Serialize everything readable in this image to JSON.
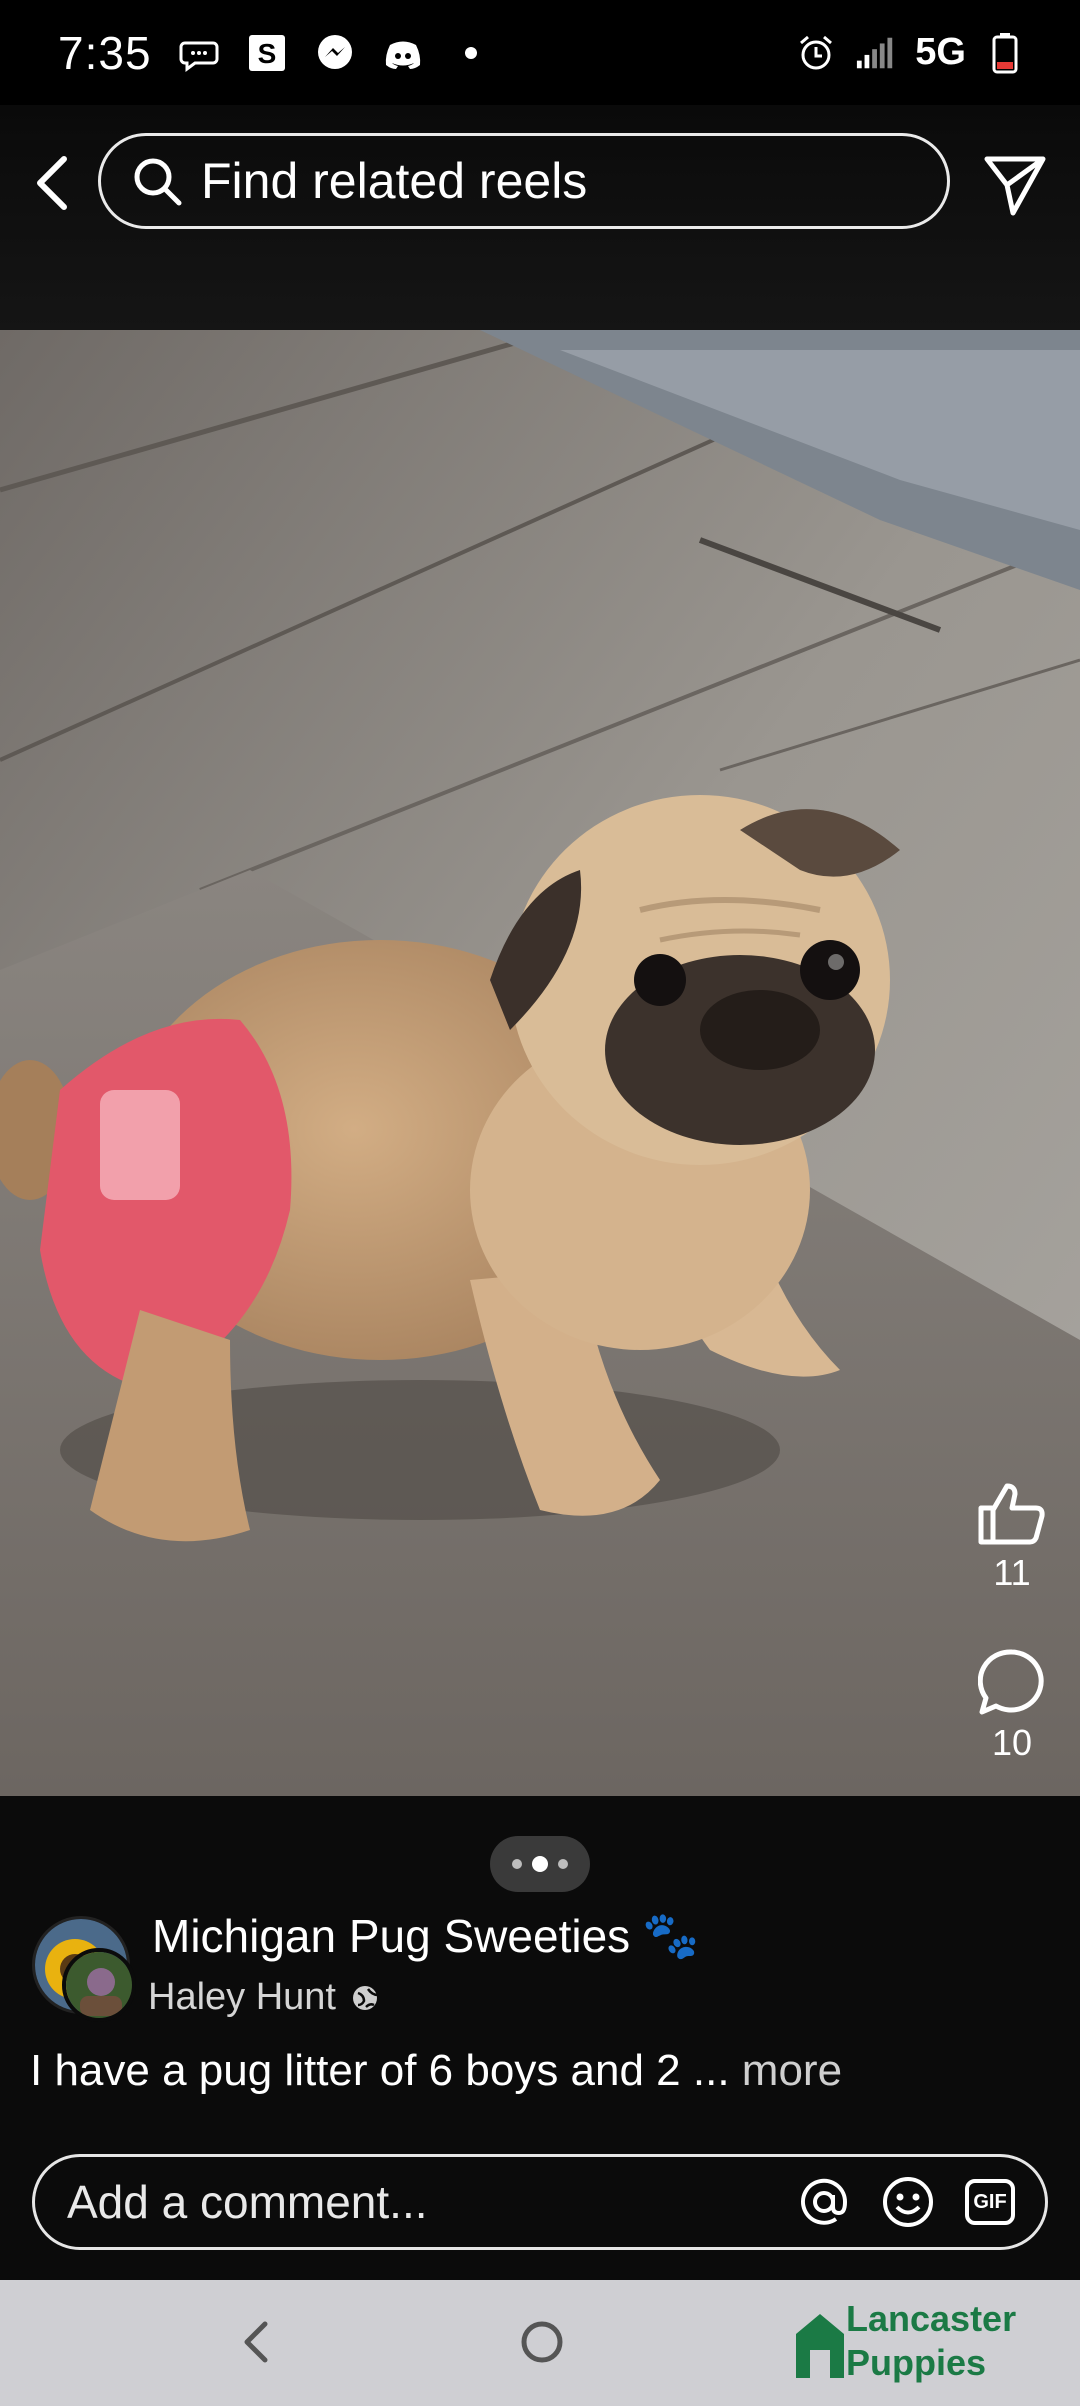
{
  "status": {
    "time": "7:35",
    "network": "5G",
    "icons": [
      "messages-icon",
      "s-app-icon",
      "messenger-icon",
      "discord-icon",
      "notification-dot-icon",
      "alarm-icon",
      "signal-icon",
      "battery-icon"
    ]
  },
  "search": {
    "placeholder": "Find related reels"
  },
  "actions": {
    "like_count": "11",
    "comment_count": "10"
  },
  "post": {
    "page_name": "Michigan Pug Sweeties",
    "page_emoji": "🐾",
    "author": "Haley Hunt",
    "caption": "I have a pug litter of 6 boys and 2 ...",
    "more_label": "more"
  },
  "comment": {
    "placeholder": "Add a comment...",
    "gif_label": "GIF"
  },
  "watermark": {
    "line1": "Lancaster",
    "line2": "Puppies"
  },
  "pager": {
    "count": 3,
    "active_index": 1
  },
  "colors": {
    "background": "#000000",
    "nav_bar": "#cfcfd3",
    "watermark_green": "#1b7a45"
  }
}
